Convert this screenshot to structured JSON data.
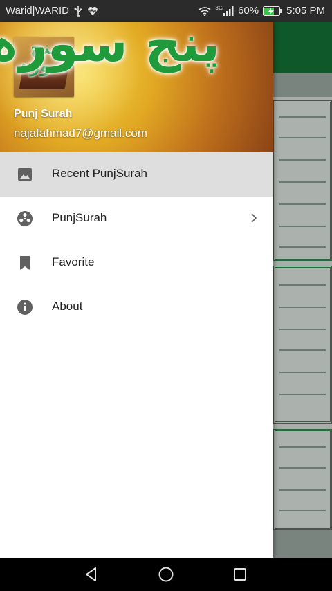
{
  "status_bar": {
    "carrier": "Warid|WARID",
    "network": "3G",
    "battery_percent": "60%",
    "time": "5:05 PM"
  },
  "drawer": {
    "header": {
      "avatar_text": "پنج سورہ",
      "big_title": "پنج سورہ",
      "app_name": "Punj Surah",
      "email": "najafahmad7@gmail.com"
    },
    "items": [
      {
        "label": "Recent PunjSurah",
        "icon": "image-icon",
        "active": true
      },
      {
        "label": "PunjSurah",
        "icon": "film-reel-icon",
        "has_submenu": true
      },
      {
        "label": "Favorite",
        "icon": "bookmark-icon"
      },
      {
        "label": "About",
        "icon": "info-icon"
      }
    ]
  },
  "colors": {
    "app_bar": "#157a3a",
    "active_item": "#dedede",
    "title_green": "#1f9b3c"
  }
}
